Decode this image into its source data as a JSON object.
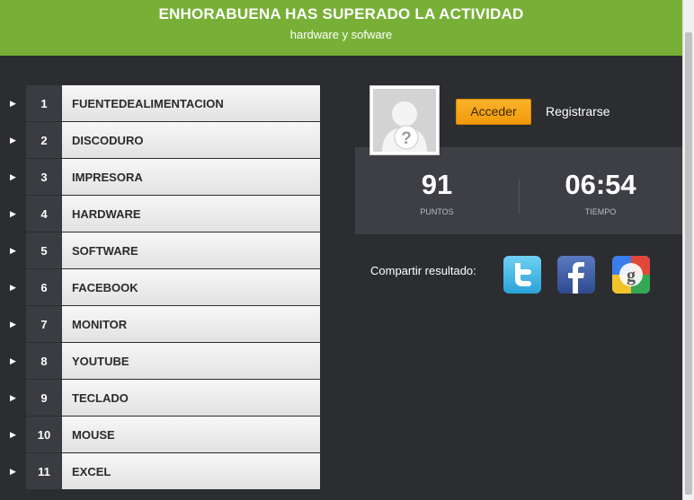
{
  "header": {
    "title": "ENHORABUENA HAS SUPERADO LA ACTIVIDAD",
    "subtitle": "hardware y sofware"
  },
  "items": [
    {
      "num": "1",
      "label": "FUENTEDEALIMENTACION"
    },
    {
      "num": "2",
      "label": "DISCODURO"
    },
    {
      "num": "3",
      "label": "IMPRESORA"
    },
    {
      "num": "4",
      "label": "HARDWARE"
    },
    {
      "num": "5",
      "label": "SOFTWARE"
    },
    {
      "num": "6",
      "label": "FACEBOOK"
    },
    {
      "num": "7",
      "label": "MONITOR"
    },
    {
      "num": "8",
      "label": "YOUTUBE"
    },
    {
      "num": "9",
      "label": "TECLADO"
    },
    {
      "num": "10",
      "label": "MOUSE"
    },
    {
      "num": "11",
      "label": "EXCEL"
    }
  ],
  "account": {
    "login_label": "Acceder",
    "register_label": "Registrarse"
  },
  "stats": {
    "points_value": "91",
    "points_label": "PUNTOS",
    "time_value": "06:54",
    "time_label": "TIEMPO"
  },
  "share": {
    "label": "Compartir resultado:",
    "icons": [
      "twitter-icon",
      "facebook-icon",
      "google-icon"
    ]
  },
  "colors": {
    "header": "#78b037",
    "background": "#2b2d31",
    "accent_button": "#f5a516",
    "stats_panel": "#3d3f44"
  }
}
